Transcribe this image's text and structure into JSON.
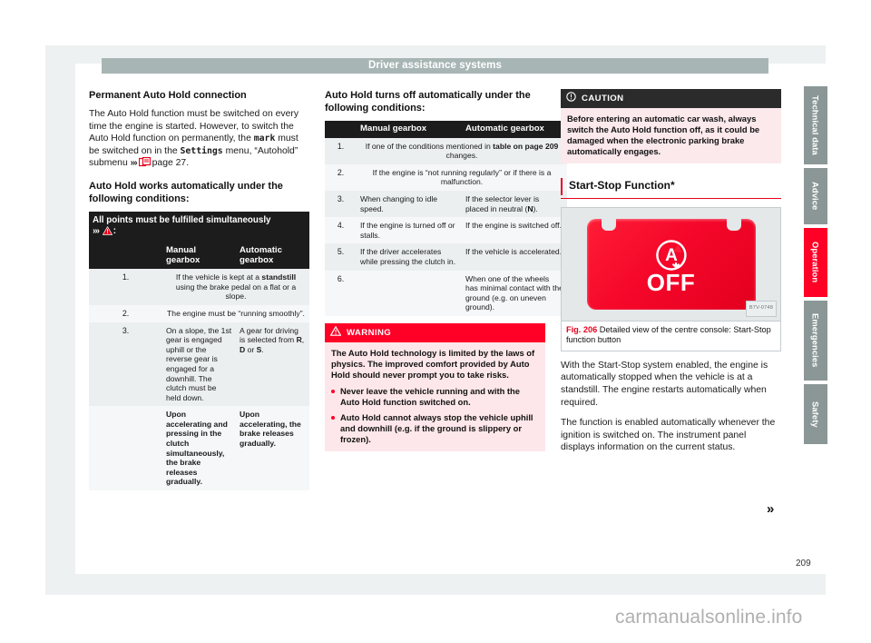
{
  "header": {
    "title": "Driver assistance systems"
  },
  "page_number": "209",
  "watermark": "carmanualsonline.info",
  "continuation_arrow": "»",
  "left_column": {
    "heading": "Permanent Auto Hold connection",
    "paragraph_parts": {
      "p1_a": "The Auto Hold function must be switched on every time the engine is started. However, to switch the Auto Hold function on permanently, the ",
      "p1_mark": "mark",
      "p1_b": " must be switched on in the ",
      "p1_settings": "Settings",
      "p1_c": " menu, “Autohold” submenu ",
      "p1_ref_chev": "›››",
      "p1_ref_page": "page 27."
    },
    "heading2": "Auto Hold works automatically under the following conditions:",
    "table": {
      "title": "All points must be fulfilled simultaneously",
      "title_ref_chev": "›››",
      "title_ref_colon": ":",
      "columns": [
        "",
        "Manual gearbox",
        "Automatic gearbox"
      ],
      "rows": [
        {
          "num": "1.",
          "span": true,
          "text_parts": {
            "a": "If the vehicle is kept at a ",
            "b": "standstill",
            "c": " using the brake pedal on a flat or a slope."
          }
        },
        {
          "num": "2.",
          "span": true,
          "text_parts": {
            "a": "The engine must be “running smoothly”.",
            "b": "",
            "c": ""
          }
        },
        {
          "num": "3.",
          "span": false,
          "manual": "On a slope, the 1st gear is engaged uphill or the reverse gear is engaged for a downhill. The clutch must be held down.",
          "auto_parts": {
            "a": "A gear for driving is selected from ",
            "r": "R",
            "sep1": ", ",
            "d": "D",
            "sep2": " or ",
            "s": "S",
            "end": "."
          }
        },
        {
          "num": "",
          "span": false,
          "bold": true,
          "manual": "Upon accelerating and pressing in the clutch simultaneously, the brake releases gradually.",
          "auto": "Upon accelerating, the brake releases gradually."
        }
      ]
    }
  },
  "middle_column": {
    "heading": "Auto Hold turns off automatically under the following conditions:",
    "table": {
      "columns": [
        "",
        "Manual gearbox",
        "Automatic gearbox"
      ],
      "rows": [
        {
          "num": "1.",
          "span": true,
          "text_parts": {
            "a": "If one of the conditions mentioned in ",
            "b": "table on page 209",
            "c": " changes."
          }
        },
        {
          "num": "2.",
          "span": true,
          "text_parts": {
            "a": "If the engine is “not running regularly” or if there is a malfunction.",
            "b": "",
            "c": ""
          }
        },
        {
          "num": "3.",
          "span": false,
          "manual": "When changing to idle speed.",
          "auto_parts": {
            "a": "If the selector lever is placed in neutral (",
            "n": "N",
            "end": ")."
          }
        },
        {
          "num": "4.",
          "span": false,
          "manual": "If the engine is turned off or stalls.",
          "auto": "If the engine is switched off."
        },
        {
          "num": "5.",
          "span": false,
          "manual": "If the driver accelerates while pressing the clutch in.",
          "auto": "If the vehicle is accelerated."
        },
        {
          "num": "6.",
          "span": false,
          "manual": "",
          "auto": "When one of the wheels has minimal contact with the ground (e.g. on uneven ground)."
        }
      ]
    },
    "warning": {
      "label": "WARNING",
      "paragraphs": [
        "The Auto Hold technology is limited by the laws of physics. The improved comfort provided by Auto Hold should never prompt you to take risks."
      ],
      "bullets": [
        "Never leave the vehicle running and with the Auto Hold function switched on.",
        "Auto Hold cannot always stop the vehicle uphill and downhill (e.g. if the ground is slippery or frozen)."
      ]
    }
  },
  "right_column": {
    "caution": {
      "label": "CAUTION",
      "text": "Before entering an automatic car wash, always switch the Auto Hold function off, as it could be damaged when the electronic parking brake automatically engages."
    },
    "section_heading": "Start-Stop Function*",
    "figure": {
      "number": "Fig. 206",
      "caption": "Detailed view of the centre console: Start-Stop function button",
      "image_code": "B7V-0748",
      "button_glyph_letter": "A",
      "button_glyph_text": "OFF"
    },
    "paragraphs": [
      "With the Start-Stop system enabled, the engine is automatically stopped when the vehicle is at a standstill. The engine restarts automatically when required.",
      "The function is enabled automatically whenever the ignition is switched on. The instrument panel displays information on the current status."
    ]
  },
  "thumb_tabs": [
    {
      "label": "Technical data",
      "active": false
    },
    {
      "label": "Advice",
      "active": false
    },
    {
      "label": "Operation",
      "active": true
    },
    {
      "label": "Emergencies",
      "active": false
    },
    {
      "label": "Safety",
      "active": false
    }
  ],
  "colors": {
    "accent_red": "#e8001c",
    "warning_red": "#ff0026",
    "header_gray": "#a8b5b5",
    "tab_gray": "#8a9796"
  }
}
